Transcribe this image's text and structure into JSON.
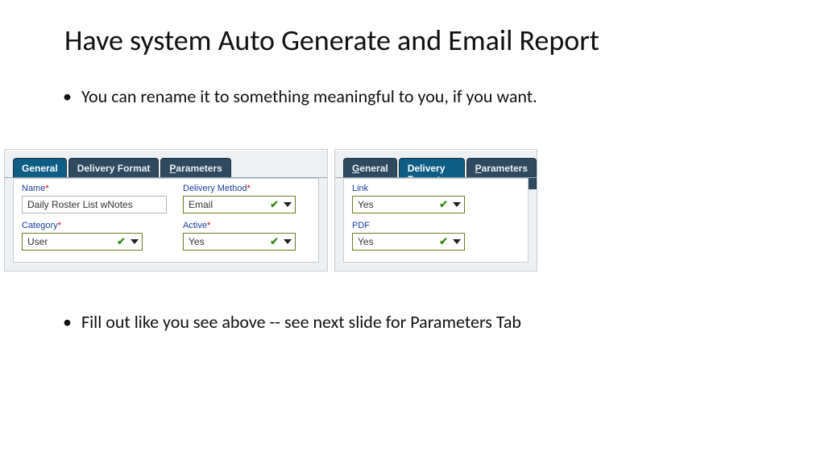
{
  "title": "Have system Auto Generate and Email Report",
  "bullets": {
    "b1": "You can rename it to something meaningful to you, if you want.",
    "b2": "Fill out like you see above  -- see next slide for Parameters Tab"
  },
  "left_panel": {
    "tabs": {
      "general": {
        "label": "General",
        "active": true
      },
      "delivery": {
        "label": "Delivery Format",
        "active": false
      },
      "params": {
        "prefix": "P",
        "rest": "arameters",
        "active": false
      }
    },
    "fields": {
      "name": {
        "label": "Name",
        "value": "Daily Roster List wNotes"
      },
      "category": {
        "label": "Category",
        "value": "User"
      },
      "delivery": {
        "label": "Delivery Method",
        "value": "Email"
      },
      "active": {
        "label": "Active",
        "value": "Yes"
      }
    }
  },
  "right_panel": {
    "tabs": {
      "general": {
        "prefix": "G",
        "rest": "eneral",
        "active": false
      },
      "delivery": {
        "label": "Delivery Format",
        "active": true
      },
      "params": {
        "prefix": "P",
        "rest": "arameters",
        "active": false
      }
    },
    "fields": {
      "link": {
        "label": "Link",
        "value": "Yes"
      },
      "pdf": {
        "label": "PDF",
        "value": "Yes"
      }
    }
  }
}
